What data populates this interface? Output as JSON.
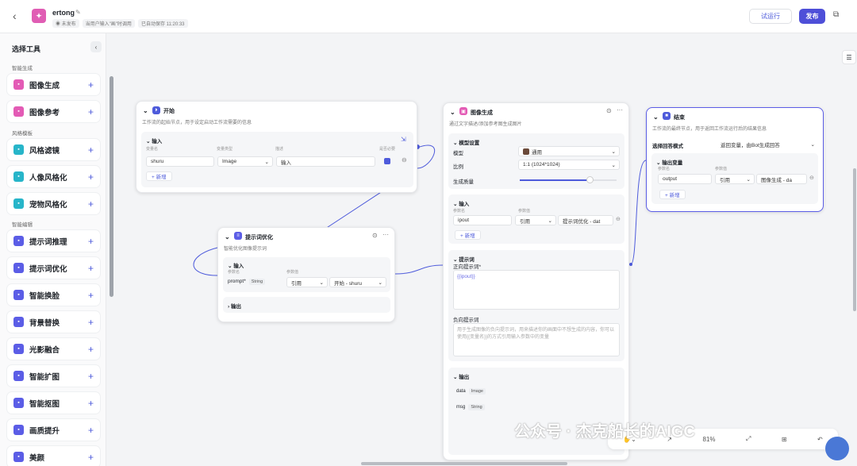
{
  "header": {
    "back": "‹",
    "app_icon": "✦",
    "app_name": "ertong",
    "status": "◉ 未发布",
    "hint": "当用户输入\"画\"时调用",
    "autosave": "已自动保存 11:20:33",
    "run": "试运行",
    "publish": "发布"
  },
  "sidebar": {
    "title": "选择工具",
    "collapse": "‹",
    "sections": [
      "智能生成",
      "风格模板",
      "智能编辑"
    ],
    "items": [
      {
        "label": "图像生成",
        "color": "#e35bb5"
      },
      {
        "label": "图像参考",
        "color": "#e35bb5"
      },
      {
        "label": "风格滤镜",
        "color": "#27b5c9"
      },
      {
        "label": "人像风格化",
        "color": "#27b5c9"
      },
      {
        "label": "宠物风格化",
        "color": "#27b5c9"
      },
      {
        "label": "提示词推理",
        "color": "#5b5de6"
      },
      {
        "label": "提示词优化",
        "color": "#5b5de6"
      },
      {
        "label": "智能换脸",
        "color": "#5b5de6"
      },
      {
        "label": "背景替换",
        "color": "#5b5de6"
      },
      {
        "label": "光影融合",
        "color": "#5b5de6"
      },
      {
        "label": "智能扩图",
        "color": "#5b5de6"
      },
      {
        "label": "智能抠图",
        "color": "#5b5de6"
      },
      {
        "label": "画质提升",
        "color": "#5b5de6"
      },
      {
        "label": "美颜",
        "color": "#5b5de6"
      }
    ],
    "add": "+"
  },
  "start": {
    "title": "开始",
    "desc": "工作流的起始节点，用于设定启动工作流需要的信息",
    "input": "输入",
    "col1": "变量名",
    "col2": "变量类型",
    "col3": "描述",
    "col4": "是否必要",
    "var": "shuru",
    "type": "Image",
    "descv": "输入",
    "add": "+ 新增"
  },
  "opt": {
    "title": "提示词优化",
    "desc": "智能优化图像提示词",
    "input": "输入",
    "c1": "参数名",
    "c2": "参数值",
    "pname": "prompt*",
    "ptype": "String",
    "ref": "引用",
    "val": "开始 - shuru",
    "output": "输出"
  },
  "gen": {
    "title": "图像生成",
    "desc": "通过文字描述/添加参考图生成图片",
    "model_set": "模型设置",
    "model": "模型",
    "model_val": "通用",
    "ratio": "比例",
    "ratio_val": "1:1 (1024*1024)",
    "quality": "生成质量",
    "quality_level": 0.72,
    "input": "输入",
    "c1": "参数名",
    "c2": "参数值",
    "iname": "ipout",
    "iref": "引用",
    "ival": "提示词优化 - dat",
    "add": "+ 新增",
    "prompt": "提示词",
    "pos": "正向提示词*",
    "pos_val": "{{ipout}}",
    "neg": "负向提示词",
    "neg_ph": "用于生成图像的负向提示词，用来描述你的画面中不想生成的内容，你可以使用{{变量名}}的方式引用输入参数中的变量",
    "output": "输出",
    "o1": "data",
    "o1t": "Image",
    "o2": "msg",
    "o2t": "String"
  },
  "end": {
    "title": "结束",
    "desc": "工作流的最终节点，用于返回工作流运行后的结果信息",
    "mode_label": "选择回答模式",
    "mode_val": "返回变量，由Bot生成回答",
    "out": "输出变量",
    "c1": "参数名",
    "c2": "参数值",
    "name": "output",
    "ref": "引用",
    "val": "图像生成 - da",
    "add": "+ 新增"
  },
  "toolbar": {
    "zoom": "81%"
  },
  "watermark": "公众号 · 杰克船长的AIGC"
}
